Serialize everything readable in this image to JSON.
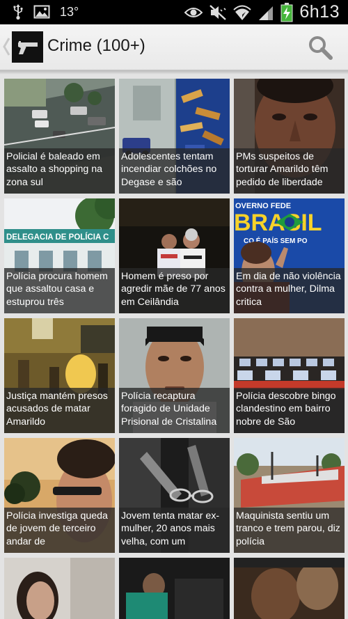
{
  "status_bar": {
    "temperature": "13°",
    "time": "6h13",
    "icons": [
      "usb-icon",
      "image-notification-icon",
      "eye-icon",
      "mute-icon",
      "wifi-icon",
      "signal-icon",
      "battery-charging-icon"
    ],
    "battery_color": "#46b63c"
  },
  "header": {
    "title": "Crime (100+)",
    "icons": [
      "back-chevron-icon",
      "gun-icon",
      "search-icon"
    ]
  },
  "articles": [
    {
      "title": "Policial é baleado em assalto a shopping na zona sul"
    },
    {
      "title": "Adolescentes tentam incendiar colchões no Degase e são"
    },
    {
      "title": "PMs suspeitos de torturar Amarildo têm pedido de liberdade"
    },
    {
      "title": "Polícia procura homem que assaltou casa e estuprou três"
    },
    {
      "title": "Homem é preso por agredir mãe de 77 anos em Ceilândia"
    },
    {
      "title": "Em dia de não violência contra a mulher, Dilma critica"
    },
    {
      "title": "Justiça mantém presos acusados de matar Amarildo"
    },
    {
      "title": "Polícia recaptura foragido de Unidade Prisional de Cristalina"
    },
    {
      "title": "Polícia descobre bingo clandestino em bairro nobre de São"
    },
    {
      "title": "Polícia investiga queda de jovem de terceiro andar de"
    },
    {
      "title": "Jovem tenta matar ex-mulher, 20 anos mais velha, com um"
    },
    {
      "title": "Maquinista sentiu um tranco e trem parou, diz polícia"
    },
    {
      "title": ""
    },
    {
      "title": ""
    },
    {
      "title": ""
    }
  ],
  "photo_text": {
    "delegacia_sign": "DELEGACIA DE POLÍCIA C",
    "brasil_banner_top": "OVERNO FEDE",
    "brasil_banner_word": "BRASIL",
    "brasil_banner_bottom": "CO É PAÍS SEM PO"
  }
}
